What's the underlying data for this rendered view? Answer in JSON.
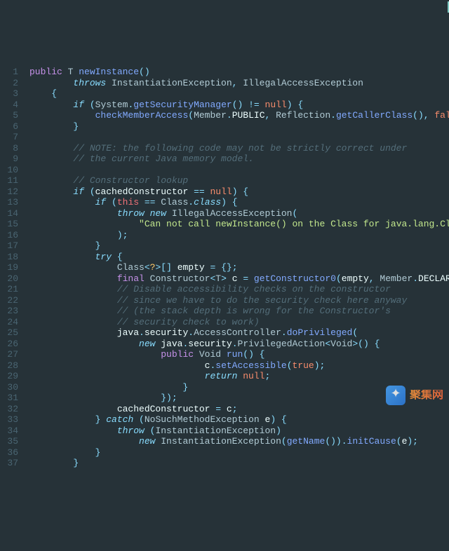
{
  "watermark": {
    "text": "聚集网"
  },
  "lines": [
    {
      "n": 1,
      "segs": [
        [
          "purple",
          "public "
        ],
        [
          "type",
          "T "
        ],
        [
          "fn",
          "newInstance"
        ],
        [
          "punc",
          "()"
        ]
      ]
    },
    {
      "n": 2,
      "segs": [
        [
          "kw2",
          "        throws "
        ],
        [
          "type",
          "InstantiationException"
        ],
        [
          "punc",
          ", "
        ],
        [
          "type",
          "IllegalAccessException"
        ]
      ]
    },
    {
      "n": 3,
      "segs": [
        [
          "punc",
          "    {"
        ]
      ]
    },
    {
      "n": 4,
      "segs": [
        [
          "white",
          "        "
        ],
        [
          "kw2",
          "if "
        ],
        [
          "punc",
          "("
        ],
        [
          "type",
          "System"
        ],
        [
          "punc",
          "."
        ],
        [
          "fn",
          "getSecurityManager"
        ],
        [
          "punc",
          "() "
        ],
        [
          "punc",
          "!= "
        ],
        [
          "null",
          "null"
        ],
        [
          "punc",
          ") {"
        ]
      ]
    },
    {
      "n": 5,
      "segs": [
        [
          "white",
          "            "
        ],
        [
          "fn",
          "checkMemberAccess"
        ],
        [
          "punc",
          "("
        ],
        [
          "type",
          "Member"
        ],
        [
          "punc",
          "."
        ],
        [
          "white",
          "PUBLIC"
        ],
        [
          "punc",
          ", "
        ],
        [
          "type",
          "Reflection"
        ],
        [
          "punc",
          "."
        ],
        [
          "fn",
          "getCallerClass"
        ],
        [
          "punc",
          "(), "
        ],
        [
          "null",
          "false"
        ],
        [
          "punc",
          ");"
        ]
      ]
    },
    {
      "n": 6,
      "segs": [
        [
          "punc",
          "        }"
        ]
      ]
    },
    {
      "n": 7,
      "segs": [
        [
          "white",
          " "
        ]
      ]
    },
    {
      "n": 8,
      "segs": [
        [
          "comm",
          "        // NOTE: the following code may not be strictly correct under"
        ]
      ]
    },
    {
      "n": 9,
      "segs": [
        [
          "comm",
          "        // the current Java memory model."
        ]
      ]
    },
    {
      "n": 10,
      "segs": [
        [
          "white",
          " "
        ]
      ]
    },
    {
      "n": 11,
      "segs": [
        [
          "comm",
          "        // Constructor lookup"
        ]
      ]
    },
    {
      "n": 12,
      "segs": [
        [
          "white",
          "        "
        ],
        [
          "kw2",
          "if "
        ],
        [
          "punc",
          "("
        ],
        [
          "white",
          "cachedConstructor "
        ],
        [
          "punc",
          "== "
        ],
        [
          "null",
          "null"
        ],
        [
          "punc",
          ") {"
        ]
      ]
    },
    {
      "n": 13,
      "segs": [
        [
          "white",
          "            "
        ],
        [
          "kw2",
          "if "
        ],
        [
          "punc",
          "("
        ],
        [
          "red",
          "this "
        ],
        [
          "punc",
          "== "
        ],
        [
          "type",
          "Class"
        ],
        [
          "punc",
          "."
        ],
        [
          "kw2",
          "class"
        ],
        [
          "punc",
          ") {"
        ]
      ]
    },
    {
      "n": 14,
      "segs": [
        [
          "white",
          "                "
        ],
        [
          "kw2",
          "throw new "
        ],
        [
          "type",
          "IllegalAccessException"
        ],
        [
          "punc",
          "("
        ]
      ]
    },
    {
      "n": 15,
      "segs": [
        [
          "white",
          "                    "
        ],
        [
          "green",
          "\"Can not call newInstance() on the Class for java.lang.Class\""
        ]
      ]
    },
    {
      "n": 16,
      "segs": [
        [
          "punc",
          "                );"
        ]
      ]
    },
    {
      "n": 17,
      "segs": [
        [
          "punc",
          "            }"
        ]
      ]
    },
    {
      "n": 18,
      "segs": [
        [
          "white",
          "            "
        ],
        [
          "kw2",
          "try "
        ],
        [
          "punc",
          "{"
        ]
      ]
    },
    {
      "n": 19,
      "segs": [
        [
          "white",
          "                "
        ],
        [
          "type",
          "Class"
        ],
        [
          "punc",
          "<"
        ],
        [
          "yellow",
          "?"
        ],
        [
          "punc",
          ">[] "
        ],
        [
          "white",
          "empty "
        ],
        [
          "punc",
          "= {};"
        ]
      ]
    },
    {
      "n": 20,
      "segs": [
        [
          "white",
          "                "
        ],
        [
          "purple",
          "final "
        ],
        [
          "type",
          "Constructor"
        ],
        [
          "punc",
          "<"
        ],
        [
          "type",
          "T"
        ],
        [
          "punc",
          "> "
        ],
        [
          "white",
          "c "
        ],
        [
          "punc",
          "= "
        ],
        [
          "fn",
          "getConstructor0"
        ],
        [
          "punc",
          "("
        ],
        [
          "white",
          "empty"
        ],
        [
          "punc",
          ", "
        ],
        [
          "type",
          "Member"
        ],
        [
          "punc",
          "."
        ],
        [
          "white",
          "DECLARED"
        ],
        [
          "punc",
          ");"
        ]
      ]
    },
    {
      "n": 21,
      "segs": [
        [
          "comm",
          "                // Disable accessibility checks on the constructor"
        ]
      ]
    },
    {
      "n": 22,
      "segs": [
        [
          "comm",
          "                // since we have to do the security check here anyway"
        ]
      ]
    },
    {
      "n": 23,
      "segs": [
        [
          "comm",
          "                // (the stack depth is wrong for the Constructor's"
        ]
      ]
    },
    {
      "n": 24,
      "segs": [
        [
          "comm",
          "                // security check to work)"
        ]
      ]
    },
    {
      "n": 25,
      "segs": [
        [
          "white",
          "                "
        ],
        [
          "white",
          "java"
        ],
        [
          "punc",
          "."
        ],
        [
          "white",
          "security"
        ],
        [
          "punc",
          "."
        ],
        [
          "type",
          "AccessController"
        ],
        [
          "punc",
          "."
        ],
        [
          "fn",
          "doPrivileged"
        ],
        [
          "punc",
          "("
        ]
      ]
    },
    {
      "n": 26,
      "segs": [
        [
          "white",
          "                    "
        ],
        [
          "kw2",
          "new "
        ],
        [
          "white",
          "java"
        ],
        [
          "punc",
          "."
        ],
        [
          "white",
          "security"
        ],
        [
          "punc",
          "."
        ],
        [
          "type",
          "PrivilegedAction"
        ],
        [
          "punc",
          "<"
        ],
        [
          "type",
          "Void"
        ],
        [
          "punc",
          ">() {"
        ]
      ]
    },
    {
      "n": 27,
      "segs": [
        [
          "white",
          "                        "
        ],
        [
          "purple",
          "public "
        ],
        [
          "type",
          "Void "
        ],
        [
          "fn",
          "run"
        ],
        [
          "punc",
          "() {"
        ]
      ]
    },
    {
      "n": 28,
      "segs": [
        [
          "white",
          "                                "
        ],
        [
          "white",
          "c"
        ],
        [
          "punc",
          "."
        ],
        [
          "fn",
          "setAccessible"
        ],
        [
          "punc",
          "("
        ],
        [
          "null",
          "true"
        ],
        [
          "punc",
          ");"
        ]
      ]
    },
    {
      "n": 29,
      "segs": [
        [
          "white",
          "                                "
        ],
        [
          "kw2",
          "return "
        ],
        [
          "null",
          "null"
        ],
        [
          "punc",
          ";"
        ]
      ]
    },
    {
      "n": 30,
      "segs": [
        [
          "punc",
          "                            }"
        ]
      ]
    },
    {
      "n": 31,
      "segs": [
        [
          "punc",
          "                        });"
        ]
      ]
    },
    {
      "n": 32,
      "segs": [
        [
          "white",
          "                "
        ],
        [
          "white",
          "cachedConstructor "
        ],
        [
          "punc",
          "= "
        ],
        [
          "white",
          "c"
        ],
        [
          "punc",
          ";"
        ]
      ]
    },
    {
      "n": 33,
      "segs": [
        [
          "white",
          "            "
        ],
        [
          "punc",
          "} "
        ],
        [
          "kw2",
          "catch "
        ],
        [
          "punc",
          "("
        ],
        [
          "type",
          "NoSuchMethodException "
        ],
        [
          "white",
          "e"
        ],
        [
          "punc",
          ") {"
        ]
      ]
    },
    {
      "n": 34,
      "segs": [
        [
          "white",
          "                "
        ],
        [
          "kw2",
          "throw "
        ],
        [
          "punc",
          "("
        ],
        [
          "type",
          "InstantiationException"
        ],
        [
          "punc",
          ")"
        ]
      ]
    },
    {
      "n": 35,
      "segs": [
        [
          "white",
          "                    "
        ],
        [
          "kw2",
          "new "
        ],
        [
          "type",
          "InstantiationException"
        ],
        [
          "punc",
          "("
        ],
        [
          "fn",
          "getName"
        ],
        [
          "punc",
          "())."
        ],
        [
          "fn",
          "initCause"
        ],
        [
          "punc",
          "("
        ],
        [
          "white",
          "e"
        ],
        [
          "punc",
          ");"
        ]
      ]
    },
    {
      "n": 36,
      "segs": [
        [
          "punc",
          "            }"
        ]
      ]
    },
    {
      "n": 37,
      "segs": [
        [
          "punc",
          "        }"
        ]
      ]
    }
  ]
}
